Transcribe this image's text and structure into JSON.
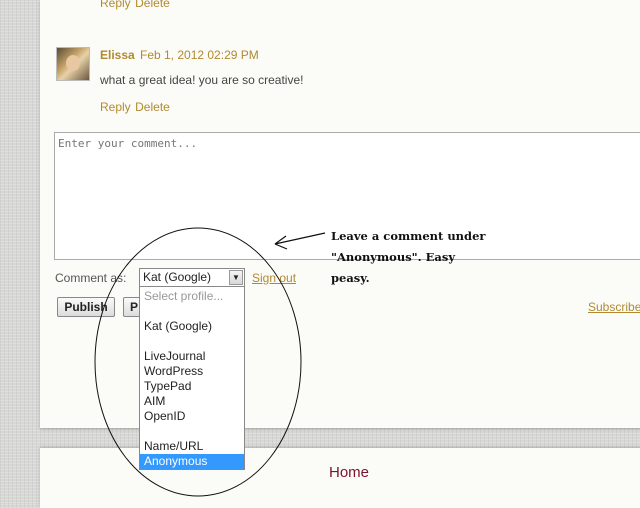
{
  "previous_comment": {
    "reply_label": "Reply",
    "delete_label": "Delete"
  },
  "comment": {
    "author": "Elissa",
    "date": "Feb 1, 2012 02:29 PM",
    "text": "what a great idea! you are so creative!",
    "reply_label": "Reply",
    "delete_label": "Delete"
  },
  "comment_form": {
    "placeholder": "Enter your comment...",
    "comment_as_label": "Comment as:",
    "selected_profile": "Kat (Google)",
    "sign_out_label": "Sign out",
    "publish_label": "Publish",
    "preview_label": "P",
    "subscribe_label": "Subscribe"
  },
  "profile_dropdown": {
    "options": [
      "Select profile...",
      "Kat (Google)",
      "LiveJournal",
      "WordPress",
      "TypePad",
      "AIM",
      "OpenID",
      "Name/URL",
      "Anonymous"
    ],
    "highlighted": "Anonymous"
  },
  "annotation": {
    "line1": "Leave a comment under",
    "line2": "\"Anonymous\". Easy",
    "line3": "peasy."
  },
  "footer": {
    "home_label": "Home"
  },
  "colors": {
    "link": "#b28a2e",
    "highlight": "#3399ff",
    "home_link": "#7a1430"
  }
}
